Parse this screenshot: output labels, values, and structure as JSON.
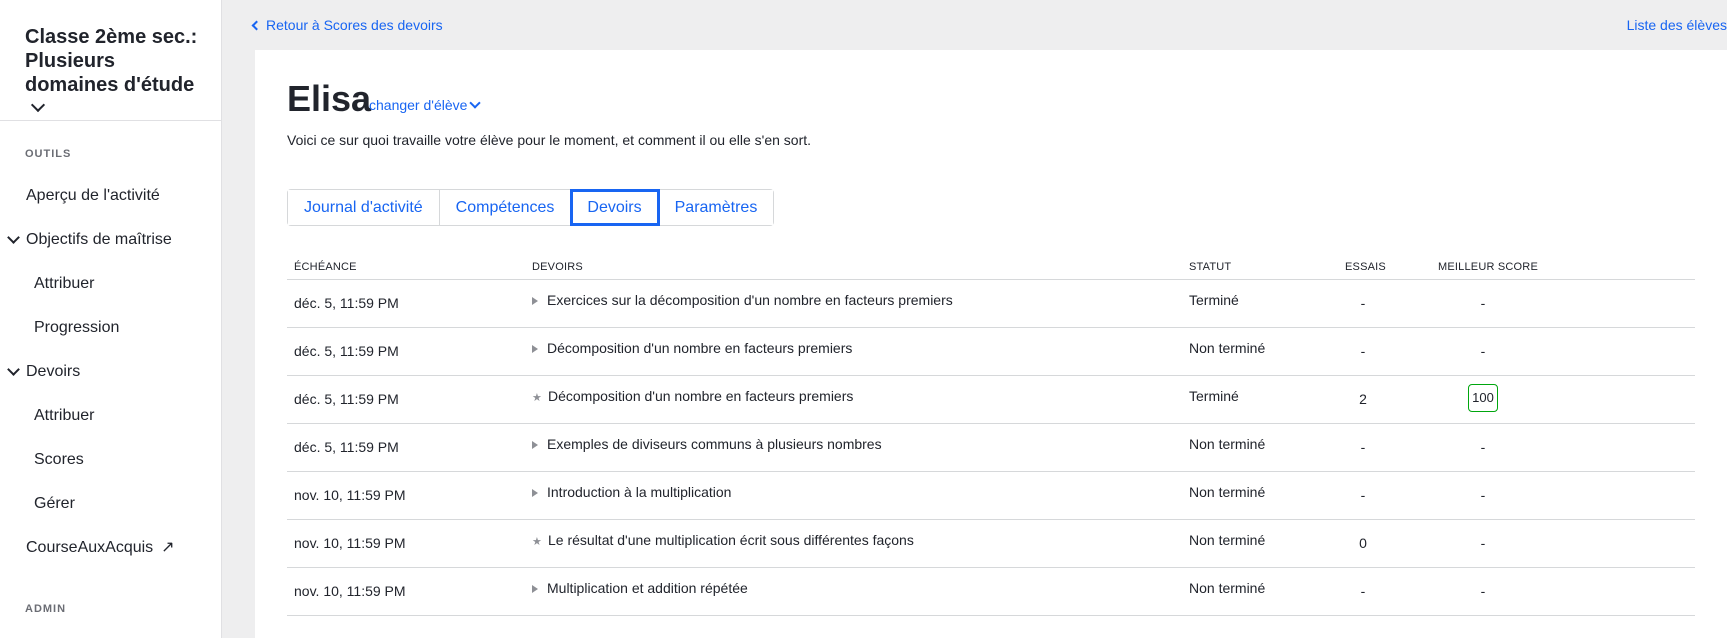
{
  "sidebar": {
    "class_title": "Classe 2ème sec.: Plusieurs domaines d'étude",
    "tools_label": "OUTILS",
    "activity_overview": "Aperçu de l'activité",
    "mastery_goals": "Objectifs de maîtrise",
    "mastery_assign": "Attribuer",
    "mastery_progress": "Progression",
    "assignments": "Devoirs",
    "assignments_assign": "Attribuer",
    "assignments_scores": "Scores",
    "assignments_manage": "Gérer",
    "course_challenge": "CourseAuxAcquis",
    "admin_label": "ADMIN"
  },
  "topbar": {
    "back_link": "Retour à Scores des devoirs",
    "students_list": "Liste des élèves"
  },
  "student": {
    "name": "Elisa",
    "change_label": "changer d'élève",
    "subtitle": "Voici ce sur quoi travaille votre élève pour le moment, et comment il ou elle s'en sort."
  },
  "tabs": [
    {
      "label": "Journal d'activité",
      "active": false
    },
    {
      "label": "Compétences",
      "active": false
    },
    {
      "label": "Devoirs",
      "active": true
    },
    {
      "label": "Paramètres",
      "active": false
    }
  ],
  "table": {
    "headers": {
      "due": "ÉCHÉANCE",
      "title": "DEVOIRS",
      "status": "STATUT",
      "tries": "ESSAIS",
      "best_score": "MEILLEUR SCORE"
    },
    "rows": [
      {
        "due": "déc. 5, 11:59 PM",
        "icon": "play-icon",
        "title": "Exercices sur la décomposition d'un nombre en facteurs premiers",
        "status": "Terminé",
        "tries": "-",
        "score": "-"
      },
      {
        "due": "déc. 5, 11:59 PM",
        "icon": "play-icon",
        "title": "Décomposition d'un nombre en facteurs premiers",
        "status": "Non terminé",
        "tries": "-",
        "score": "-"
      },
      {
        "due": "déc. 5, 11:59 PM",
        "icon": "star-icon",
        "title": "Décomposition d'un nombre en facteurs premiers",
        "status": "Terminé",
        "tries": "2",
        "score": "100"
      },
      {
        "due": "déc. 5, 11:59 PM",
        "icon": "play-icon",
        "title": "Exemples de diviseurs communs à plusieurs nombres",
        "status": "Non terminé",
        "tries": "-",
        "score": "-"
      },
      {
        "due": "nov. 10, 11:59 PM",
        "icon": "play-icon",
        "title": "Introduction à la multiplication",
        "status": "Non terminé",
        "tries": "-",
        "score": "-"
      },
      {
        "due": "nov. 10, 11:59 PM",
        "icon": "star-icon",
        "title": "Le résultat d'une multiplication écrit sous différentes façons",
        "status": "Non terminé",
        "tries": "0",
        "score": "-"
      },
      {
        "due": "nov. 10, 11:59 PM",
        "icon": "play-icon",
        "title": "Multiplication et addition répétée",
        "status": "Non terminé",
        "tries": "-",
        "score": "-"
      }
    ]
  },
  "colors": {
    "link": "#1865f2",
    "text": "#21242c",
    "score_border": "#00a60e",
    "background": "#eeeeef"
  }
}
